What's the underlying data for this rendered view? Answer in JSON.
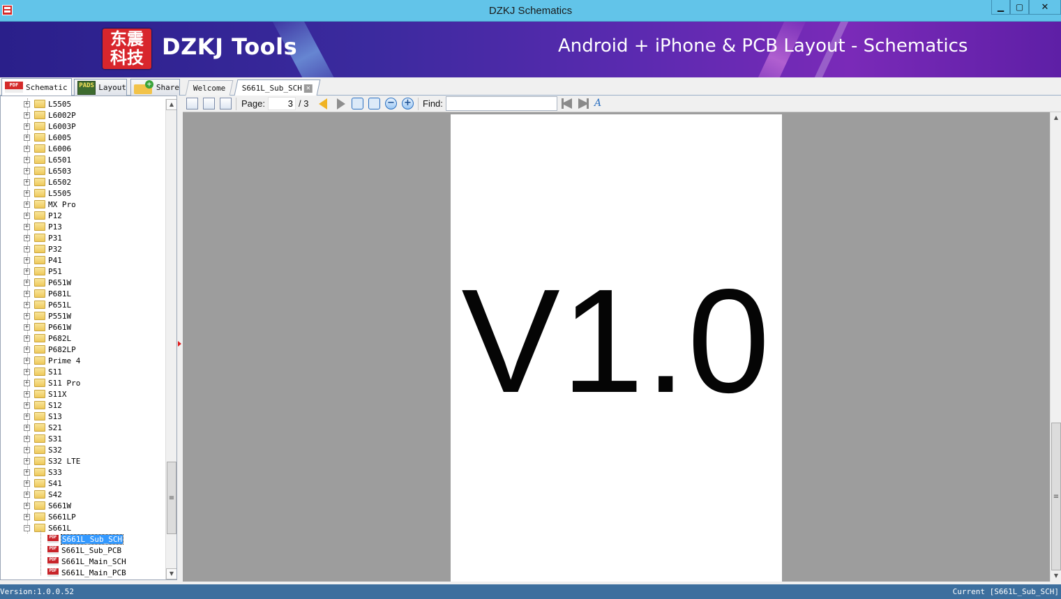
{
  "window": {
    "title": "DZKJ Schematics"
  },
  "banner": {
    "logo_line1": "东震",
    "logo_line2": "科技",
    "brand": "DZKJ Tools",
    "tagline": "Android + iPhone & PCB Layout - Schematics"
  },
  "left_tabs": [
    {
      "label": "Schematic",
      "icon_text": "PDF"
    },
    {
      "label": "Layout",
      "icon_text": "PADS"
    },
    {
      "label": "Share"
    }
  ],
  "doc_tabs": [
    {
      "label": "Welcome"
    },
    {
      "label": "S661L_Sub_SCH",
      "close": "✕"
    }
  ],
  "tree": {
    "folders": [
      "L5505",
      "L6002P",
      "L6003P",
      "L6005",
      "L6006",
      "L6501",
      "L6503",
      "L6502",
      "L5505",
      "MX Pro",
      "P12",
      "P13",
      "P31",
      "P32",
      "P41",
      "P51",
      "P651W",
      "P681L",
      "P651L",
      "P551W",
      "P661W",
      "P682L",
      "P682LP",
      "Prime 4",
      "S11",
      "S11 Pro",
      "S11X",
      "S12",
      "S13",
      "S21",
      "S31",
      "S32",
      "S32 LTE",
      "S33",
      "S41",
      "S42",
      "S661W",
      "S661LP",
      "S661L"
    ],
    "files": [
      "S661L_Sub_SCH",
      "S661L_Sub_PCB",
      "S661L_Main_SCH",
      "S661L_Main_PCB"
    ],
    "selected_file_index": 0,
    "pdf_icon_text": "PDF"
  },
  "toolbar": {
    "page_label": "Page:",
    "page_current": "3",
    "page_total": "/ 3",
    "find_label": "Find:",
    "find_value": ""
  },
  "document": {
    "page_text": "V1.0"
  },
  "status": {
    "version": "Version:1.0.0.52",
    "current": "Current [S661L_Sub_SCH]"
  },
  "colors": {
    "titlebar": "#62c4e9",
    "statusbar": "#3d6f9e",
    "selection": "#3399ff",
    "viewer_bg": "#9d9d9d"
  }
}
